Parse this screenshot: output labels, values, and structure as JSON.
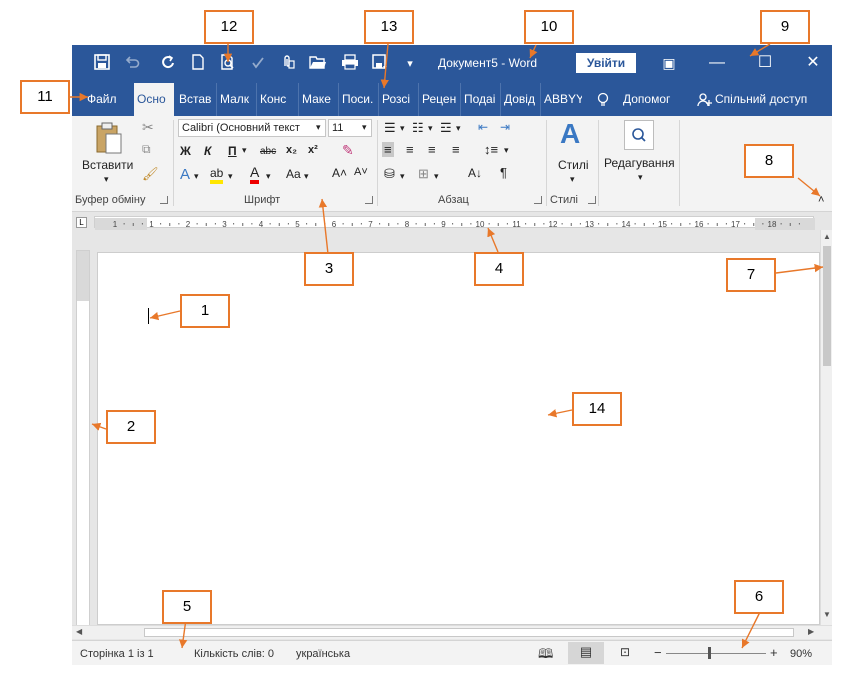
{
  "titlebar": {
    "doc_title": "Документ5  -  Word",
    "signin_label": "Увійти",
    "save_icon": "save-icon",
    "undo_icon": "undo-icon",
    "redo_icon": "redo-icon",
    "new_icon": "new-document-icon",
    "preview_icon": "print-preview-icon",
    "minimize": "—",
    "restore": "☐",
    "close": "✕",
    "ribbon_options": "▣",
    "customize": "▾"
  },
  "tabs": {
    "file": "Файл",
    "home": "Осно",
    "insert": "Встав",
    "draw": "Малк",
    "design": "Конс",
    "layout": "Маке",
    "references": "Поси.",
    "mailings": "Розсі",
    "review": "Рецен",
    "view": "Подаі",
    "help": "Довід",
    "abbyy": "ABBYY",
    "tellme": "Допомог",
    "share": "Спільний доступ"
  },
  "ribbon": {
    "paste_label": "Вставити",
    "clipboard_group": "Буфер обміну",
    "font_name": "Calibri (Основний текст",
    "font_size": "11",
    "font_group": "Шрифт",
    "paragraph_group": "Абзац",
    "styles_label": "Стилі",
    "styles_group": "Стилі",
    "editing_label": "Редагування",
    "bold": "Ж",
    "italic": "К",
    "underline": "П",
    "strike": "abc",
    "sub": "x₂",
    "sup": "x²",
    "aa": "Aa",
    "grow": "A˄",
    "shrink": "A˅",
    "pilcrow": "¶"
  },
  "ruler": {
    "marks": [
      "1",
      "1",
      "2",
      "3",
      "4",
      "5",
      "6",
      "7",
      "8",
      "9",
      "10",
      "11",
      "12",
      "13",
      "14",
      "15",
      "16",
      "17",
      "18"
    ]
  },
  "status": {
    "page": "Сторінка 1 із 1",
    "words": "Кількість слів: 0",
    "language": "українська",
    "zoom": "90%",
    "zoom_minus": "−",
    "zoom_plus": "+"
  },
  "callouts": [
    "1",
    "2",
    "3",
    "4",
    "5",
    "6",
    "7",
    "8",
    "9",
    "10",
    "11",
    "12",
    "13",
    "14"
  ],
  "colors": {
    "title_bar": "#2b579a",
    "callout_border": "#e8782a"
  }
}
